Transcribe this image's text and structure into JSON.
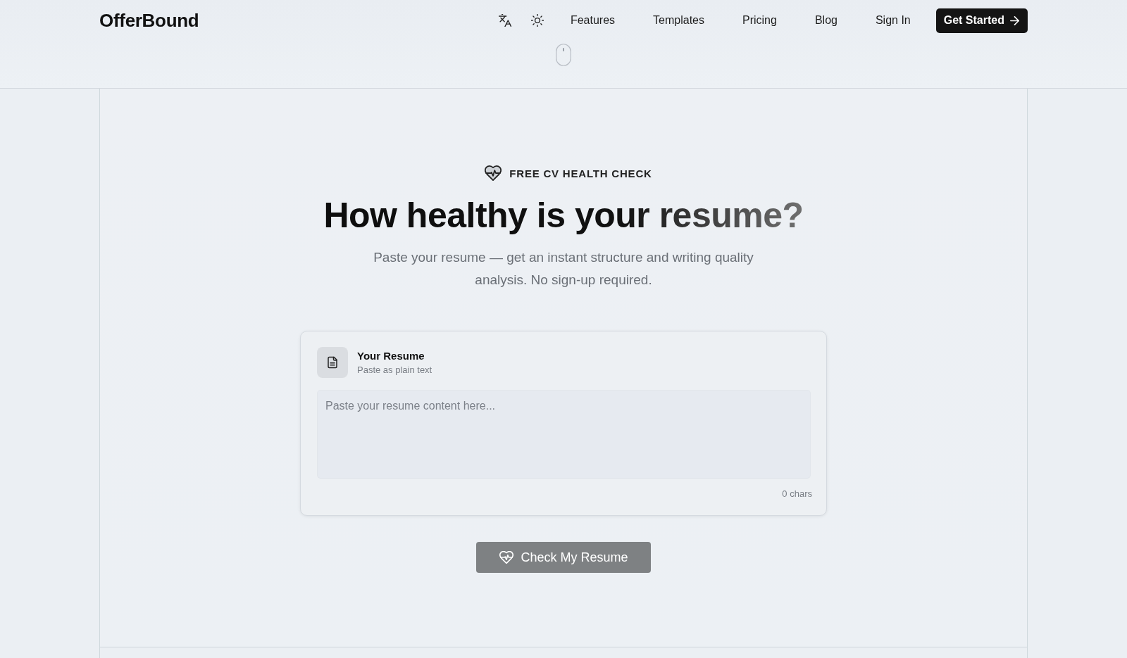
{
  "header": {
    "logo": "OfferBound",
    "nav": [
      "Features",
      "Templates",
      "Pricing",
      "Blog",
      "Sign In"
    ],
    "cta": {
      "label": "Get Started"
    }
  },
  "hero": {
    "eyebrow": "FREE CV HEALTH CHECK",
    "title": "How healthy is your resume?",
    "subtitle": "Paste your resume — get an instant structure and writing quality analysis. No sign-up required."
  },
  "resume_card": {
    "title": "Your Resume",
    "subtitle": "Paste as plain text",
    "textarea": {
      "placeholder": "Paste your resume content here..."
    },
    "char_count": "0 chars"
  },
  "submit_button": {
    "label": "Check My Resume",
    "disabled": true
  }
}
